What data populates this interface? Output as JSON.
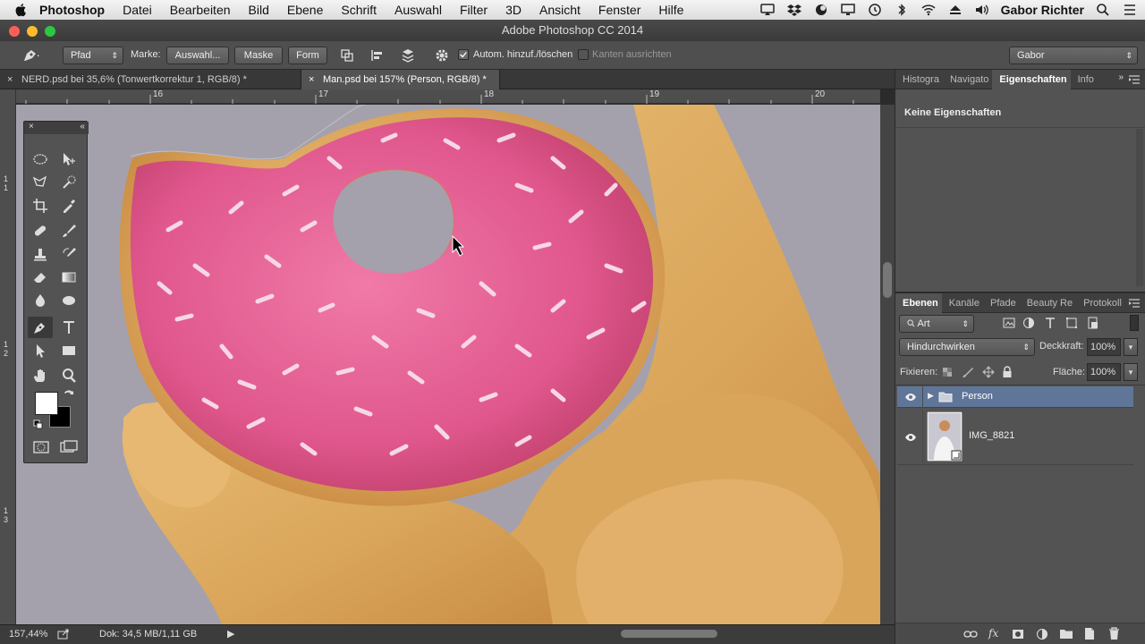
{
  "menubar": {
    "app": "Photoshop",
    "menus": [
      "Datei",
      "Bearbeiten",
      "Bild",
      "Ebene",
      "Schrift",
      "Auswahl",
      "Filter",
      "3D",
      "Ansicht",
      "Fenster",
      "Hilfe"
    ],
    "user": "Gabor Richter"
  },
  "window": {
    "title": "Adobe Photoshop CC 2014"
  },
  "options": {
    "mode": "Pfad",
    "make_label": "Marke:",
    "selection_btn": "Auswahl...",
    "mask_btn": "Maske",
    "shape_btn": "Form",
    "auto_add_delete": "Autom. hinzuf./löschen",
    "auto_checked": true,
    "align_edges": "Kanten ausrichten",
    "align_checked": false,
    "workspace": "Gabor"
  },
  "tabs": [
    {
      "label": "NERD.psd bei 35,6% (Tonwertkorrektur 1, RGB/8) *",
      "active": false
    },
    {
      "label": "Man.psd bei 157% (Person, RGB/8) *",
      "active": true
    }
  ],
  "ruler": {
    "h_labels": [
      "16",
      "17",
      "18",
      "19",
      "20"
    ],
    "v_labels": [
      "1\n1",
      "1\n2",
      "1\n3"
    ]
  },
  "status": {
    "zoom": "157,44%",
    "doc": "Dok: 34,5 MB/1,11 GB"
  },
  "props_panel": {
    "tabs": [
      "Histogra",
      "Navigato",
      "Eigenschaften",
      "Info"
    ],
    "active": "Eigenschaften",
    "content": "Keine Eigenschaften"
  },
  "layers_panel": {
    "tabs": [
      "Ebenen",
      "Kanäle",
      "Pfade",
      "Beauty Re",
      "Protokoll"
    ],
    "active": "Ebenen",
    "filter": "Art",
    "blend_mode": "Hindurchwirken",
    "opacity_label": "Deckkraft:",
    "opacity": "100%",
    "lock_label": "Fixieren:",
    "fill_label": "Fläche:",
    "fill": "100%",
    "layers": [
      {
        "name": "Person",
        "type": "group",
        "visible": true,
        "selected": true
      },
      {
        "name": "IMG_8821",
        "type": "smart-object",
        "visible": true,
        "selected": false
      }
    ]
  }
}
